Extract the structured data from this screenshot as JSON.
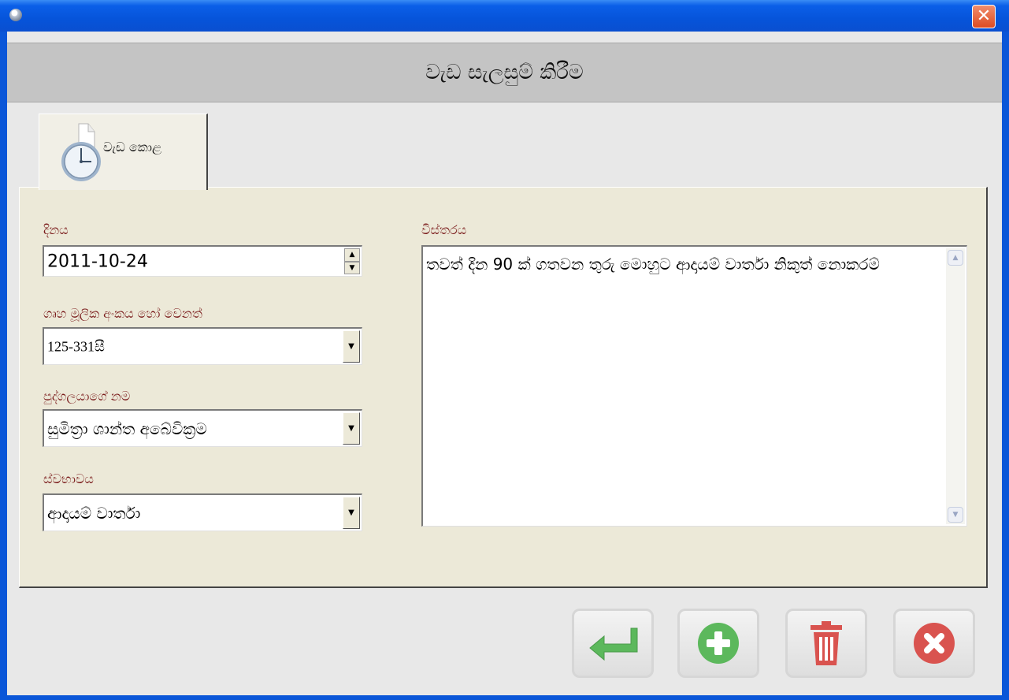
{
  "window": {
    "title_icon": "app-icon",
    "close_icon": "close-icon",
    "close_glyph": "✕"
  },
  "header": {
    "title": "වැඩ සැලසුම් කිරීම"
  },
  "tabs": [
    {
      "label": "වැඩ කොළ",
      "icon": "clock-icon"
    }
  ],
  "form": {
    "date": {
      "label": "දිනය",
      "value": "2011-10-24"
    },
    "house_id": {
      "label": "ගෘහ මූලික අංකය හෝ වෙනත්",
      "value": "125-331සී"
    },
    "person_name": {
      "label": "පුද්ගලයාගේ නම",
      "value": "සුමිත්‍රා ශාන්ත අබේවික්‍රම"
    },
    "nature": {
      "label": "ස්වභාවය",
      "value": "ආදායම් වාර්තා"
    },
    "description": {
      "label": "විස්තරය",
      "value": "තවත් දින 90 ක් ගතවන තුරු මොහුට ආදායම් වාර්තා නිකුත් නොකරම්"
    }
  },
  "actions": [
    {
      "name": "enter-button",
      "icon": "enter-arrow-icon",
      "color": "#5cb85c"
    },
    {
      "name": "add-button",
      "icon": "plus-icon",
      "color": "#5cb85c"
    },
    {
      "name": "delete-button",
      "icon": "trash-icon",
      "color": "#d9534f"
    },
    {
      "name": "cancel-button",
      "icon": "close-circle-icon",
      "color": "#d9534f"
    }
  ],
  "colors": {
    "titlebar": "#0654da",
    "label": "#7a1a1a",
    "panel": "#ece9d8"
  }
}
